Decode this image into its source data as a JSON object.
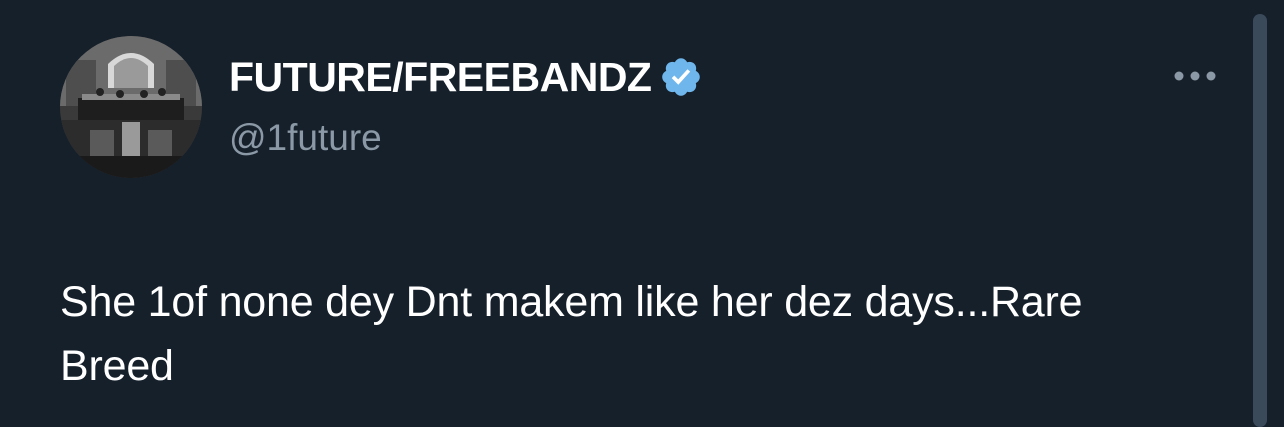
{
  "author": {
    "display_name": "FUTURE/FREEBANDZ",
    "handle": "@1future",
    "verified": true,
    "avatar_alt": "profile photo (grayscale courtroom scene)"
  },
  "tweet": {
    "text": "She 1of none dey Dnt makem like her dez days...Rare Breed"
  },
  "icons": {
    "verified": "verified-badge-icon",
    "more": "more-options-icon"
  },
  "colors": {
    "background": "#15202b",
    "text_primary": "#ffffff",
    "text_secondary": "#8b98a5",
    "verified_blue": "#6fb6ec"
  }
}
